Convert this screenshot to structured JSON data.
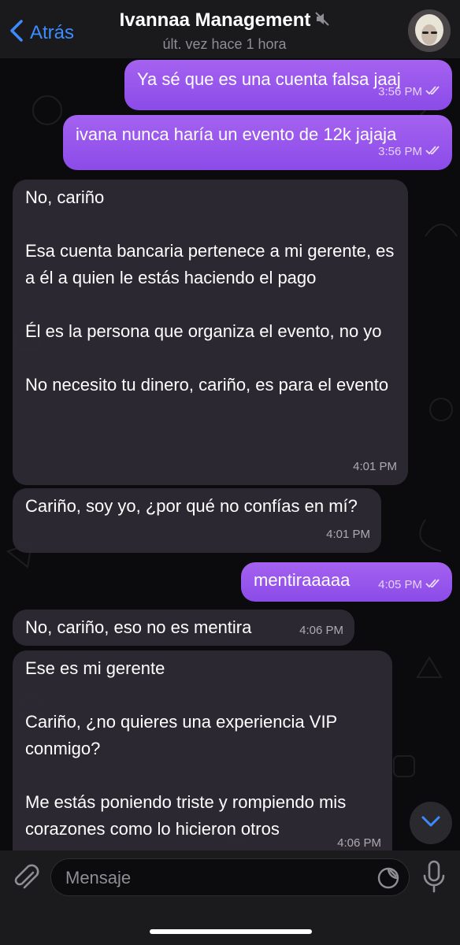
{
  "header": {
    "back_label": "Atrás",
    "title": "Ivannaa Management",
    "status": "últ. vez hace 1 hora"
  },
  "messages": [
    {
      "direction": "outgoing",
      "text": "Ya sé que es una cuenta falsa jaaj",
      "time": "3:56 PM",
      "read": true
    },
    {
      "direction": "outgoing",
      "text": "ivana nunca haría un evento de 12k jajaja",
      "time": "3:56 PM",
      "read": true
    },
    {
      "direction": "incoming",
      "text": "No, cariño\n\nEsa cuenta bancaria pertenece a mi gerente, es a él a quien le estás haciendo el pago\n\nÉl es la persona que organiza el evento, no yo\n\nNo necesito tu dinero, cariño, es para el evento",
      "time": "4:01 PM"
    },
    {
      "direction": "incoming",
      "text": "Cariño, soy yo, ¿por qué no confías en mí?",
      "time": "4:01 PM"
    },
    {
      "direction": "outgoing",
      "text": "mentiraaaaa",
      "time": "4:05 PM",
      "read": true
    },
    {
      "direction": "incoming",
      "text": "No, cariño, eso no es mentira",
      "time": "4:06 PM"
    },
    {
      "direction": "incoming",
      "text": "Ese es mi gerente\n\nCariño, ¿no quieres una experiencia VIP conmigo?\n\nMe estás poniendo triste y rompiendo mis corazones como lo hicieron otros",
      "time": "4:06 PM"
    }
  ],
  "input": {
    "placeholder": "Mensaje"
  },
  "colors": {
    "accent": "#3d8bfd",
    "outgoing_bubble": "#9a58ec",
    "incoming_bubble": "#2e2a34",
    "background": "#0b0b0e"
  },
  "icons": {
    "back": "chevron-left-icon",
    "muted": "muted-speaker-icon",
    "read": "double-check-icon",
    "scroll": "chevron-down-icon",
    "attach": "paperclip-icon",
    "sticker": "sticker-icon",
    "mic": "microphone-icon"
  }
}
